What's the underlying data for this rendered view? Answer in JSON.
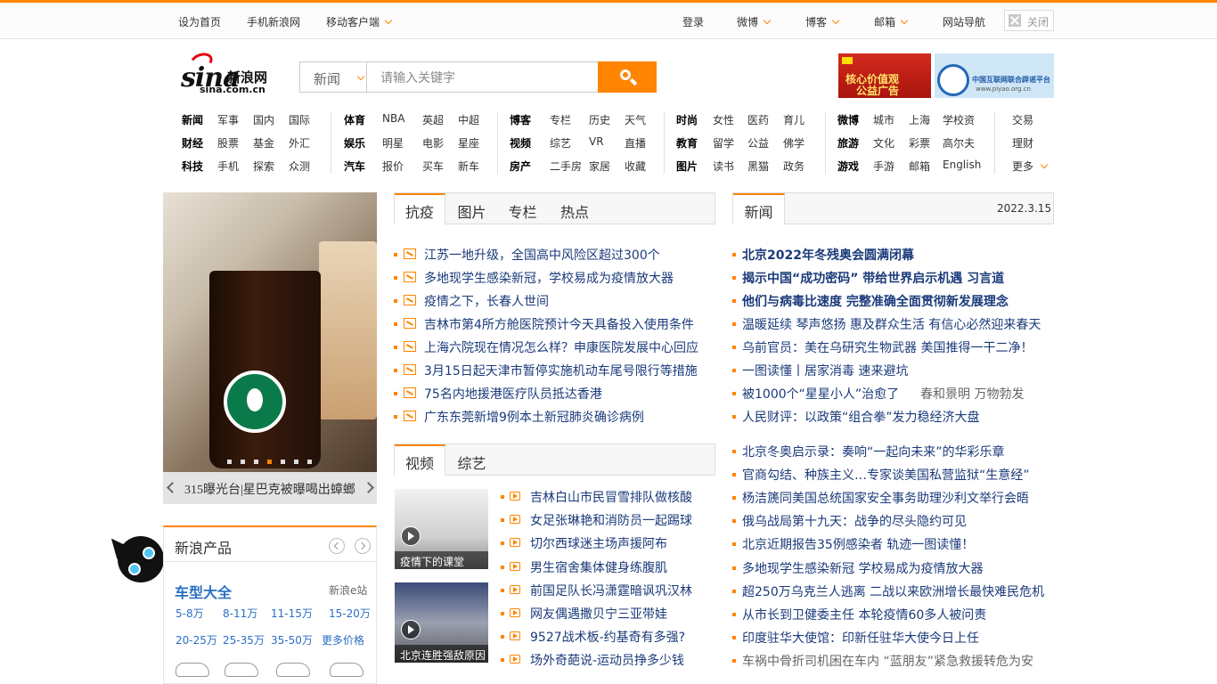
{
  "topbar": {
    "set_home": "设为首页",
    "mobile_sina": "手机新浪网",
    "mobile_client": "移动客户端",
    "login": "登录",
    "weibo": "微博",
    "blog": "博客",
    "mail": "邮箱",
    "site_nav": "网站导航",
    "close": "关闭"
  },
  "logo": {
    "brand": "sina",
    "cn": "新浪网",
    "domain": "sina.com.cn"
  },
  "search": {
    "category": "新闻",
    "placeholder": "请输入关键字"
  },
  "ads": {
    "ad1_line1": "核心价值观",
    "ad1_line2": "公益广告",
    "ad2_line1": "中国互联网联合辟谣平台",
    "ad2_line2": "www.piyao.org.cn"
  },
  "nav": {
    "col1": [
      [
        "新闻",
        "军事",
        "国内",
        "国际"
      ],
      [
        "财经",
        "股票",
        "基金",
        "外汇"
      ],
      [
        "科技",
        "手机",
        "探索",
        "众测"
      ]
    ],
    "col2": [
      [
        "体育",
        "NBA",
        "英超",
        "中超"
      ],
      [
        "娱乐",
        "明星",
        "电影",
        "星座"
      ],
      [
        "汽车",
        "报价",
        "买车",
        "新车"
      ]
    ],
    "col3": [
      [
        "博客",
        "专栏",
        "历史",
        "天气"
      ],
      [
        "视频",
        "综艺",
        "VR",
        "直播"
      ],
      [
        "房产",
        "二手房",
        "家居",
        "收藏"
      ]
    ],
    "col4": [
      [
        "时尚",
        "女性",
        "医药",
        "育儿"
      ],
      [
        "教育",
        "留学",
        "公益",
        "佛学"
      ],
      [
        "图片",
        "读书",
        "黑猫",
        "政务"
      ]
    ],
    "col5": [
      [
        "微博",
        "城市",
        "上海",
        "学校资"
      ],
      [
        "旅游",
        "文化",
        "彩票",
        "高尔夫"
      ],
      [
        "游戏",
        "手游",
        "邮箱",
        "English"
      ]
    ],
    "col6": [
      "交易",
      "理财",
      "更多"
    ]
  },
  "carousel": {
    "caption": "315曝光台|星巴克被曝喝出蟑螂",
    "dot_count": 7,
    "active_dot": 3
  },
  "products": {
    "header": "新浪产品",
    "title": "车型大全",
    "subtitle": "新浪e站",
    "price_links": [
      "5-8万",
      "8-11万",
      "11-15万",
      "15-20万",
      "20-25万",
      "25-35万",
      "35-50万",
      "更多价格"
    ]
  },
  "mid_tabs": [
    "抗疫",
    "图片",
    "专栏",
    "热点"
  ],
  "mid_news": [
    "江苏一地升级，全国高中风险区超过300个",
    "多地现学生感染新冠，学校易成为疫情放大器",
    "疫情之下，长春人世间",
    "吉林市第4所方舱医院预计今天具备投入使用条件",
    "上海六院现在情况怎么样？申康医院发展中心回应",
    "3月15日起天津市暂停实施机动车尾号限行等措施",
    "75名内地援港医疗队员抵达香港",
    "广东东莞新增9例本土新冠肺炎确诊病例"
  ],
  "video_tabs": [
    "视频",
    "综艺"
  ],
  "video_thumbs": [
    "疫情下的课堂",
    "北京连胜强敌原因"
  ],
  "video_news": [
    "吉林白山市民冒雪排队做核酸",
    "女足张琳艳和消防员一起踢球",
    "切尔西球迷主场声援阿布",
    "男生宿舍集体健身练腹肌",
    "前国足队长冯潇霆暗讽巩汉林",
    "网友偶遇撒贝宁三亚带娃",
    "9527战术板-约基奇有多强?",
    "场外奇葩说-运动员挣多少钱"
  ],
  "right_tab": "新闻",
  "date": "2022.3.15",
  "top_news": [
    "北京2022年冬残奥会圆满闭幕",
    "揭示中国“成功密码” 带给世界启示机遇 习言道",
    "他们与病毒比速度 完整准确全面贯彻新发展理念"
  ],
  "right_news": [
    "温暖延续 琴声悠扬 惠及群众生活 有信心必然迎来春天",
    "乌前官员：美在乌研究生物武器 美国推得一干二净！",
    "一图读懂丨居家消毒 速来避坑",
    "被1000个“星星小人”治愈了",
    "人民财评：以政策“组合拳”发力稳经济大盘"
  ],
  "right_news_extra": "春和景明 万物勃发",
  "right_news2": [
    "北京冬奥启示录：奏响“一起向未来”的华彩乐章",
    "官商勾结、种族主义…专家谈美国私营监狱“生意经”",
    "杨洁篪同美国总统国家安全事务助理沙利文举行会晤",
    "俄乌战局第十九天：战争的尽头隐约可见",
    "北京近期报告35例感染者 轨迹一图读懂！",
    "多地现学生感染新冠 学校易成为疫情放大器",
    "超250万乌克兰人逃离 二战以来欧洲增长最快难民危机",
    "从市长到卫健委主任 本轮疫情60多人被问责",
    "印度驻华大使馆：印新任驻华大使今日上任",
    "车祸中骨折司机困在车内 “蓝朋友”紧急救援转危为安"
  ],
  "colors": {
    "accent": "#ff8400",
    "link_blue": "#1a3a7a",
    "product_blue": "#2a6fc4"
  }
}
